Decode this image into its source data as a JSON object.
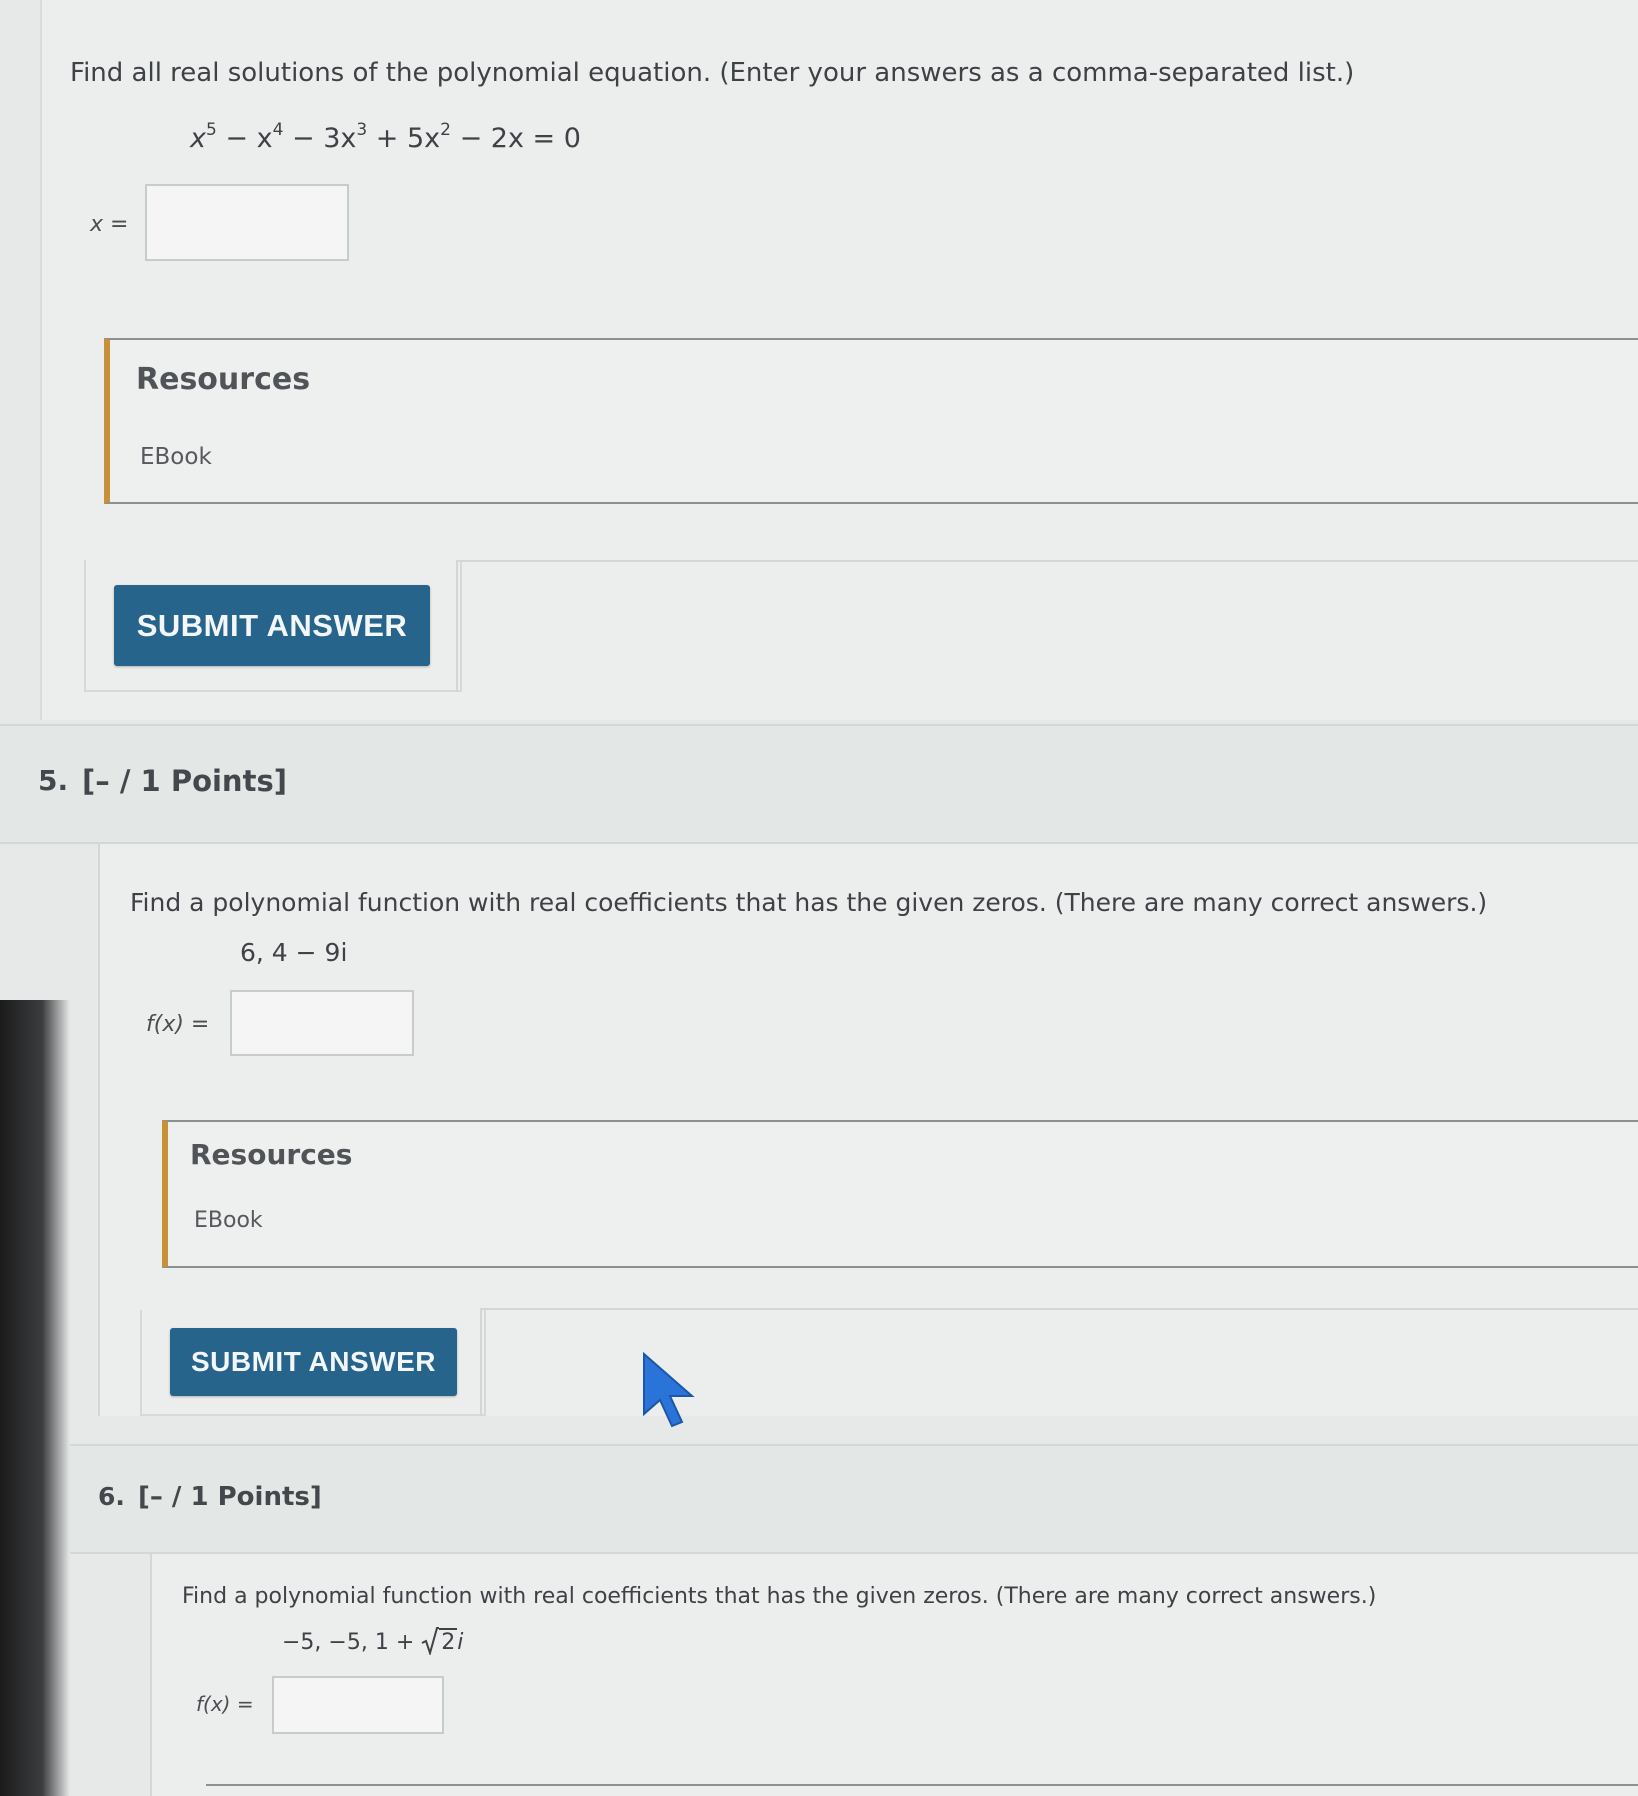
{
  "q4": {
    "prompt": "Find all real solutions of the polynomial equation. (Enter your answers as a comma-separated list.)",
    "equation": {
      "t1": "x",
      "e1": "5",
      "t2": " − x",
      "e2": "4",
      "t3": " − 3x",
      "e3": "3",
      "t4": " + 5x",
      "e4": "2",
      "t5": " − 2x = 0"
    },
    "answer_label": "x =",
    "answer_value": "",
    "resources_title": "Resources",
    "ebook_label": "EBook",
    "submit_label": "SUBMIT ANSWER"
  },
  "q5": {
    "number": "5.",
    "points": "[– / 1 Points]",
    "prompt": "Find a polynomial function with real coefficients that has the given zeros. (There are many correct answers.)",
    "zeros": "6, 4 − 9i",
    "answer_label": "f(x) =",
    "answer_value": "",
    "resources_title": "Resources",
    "ebook_label": "EBook",
    "submit_label": "SUBMIT ANSWER"
  },
  "q6": {
    "number": "6.",
    "points": "[– / 1 Points]",
    "prompt": "Find a polynomial function with real coefficients that has the given zeros. (There are many correct answers.)",
    "zeros_prefix": "−5, −5, 1 + ",
    "zeros_radicand": "2",
    "zeros_suffix": "i",
    "answer_label": "f(x) =",
    "answer_value": ""
  },
  "colors": {
    "submit_button": "#27648c",
    "resources_accent": "#c69137",
    "page_background": "#e6e9e8"
  },
  "icons": {
    "pointer": "mouse-pointer-icon",
    "sqrt": "square-root-icon"
  }
}
